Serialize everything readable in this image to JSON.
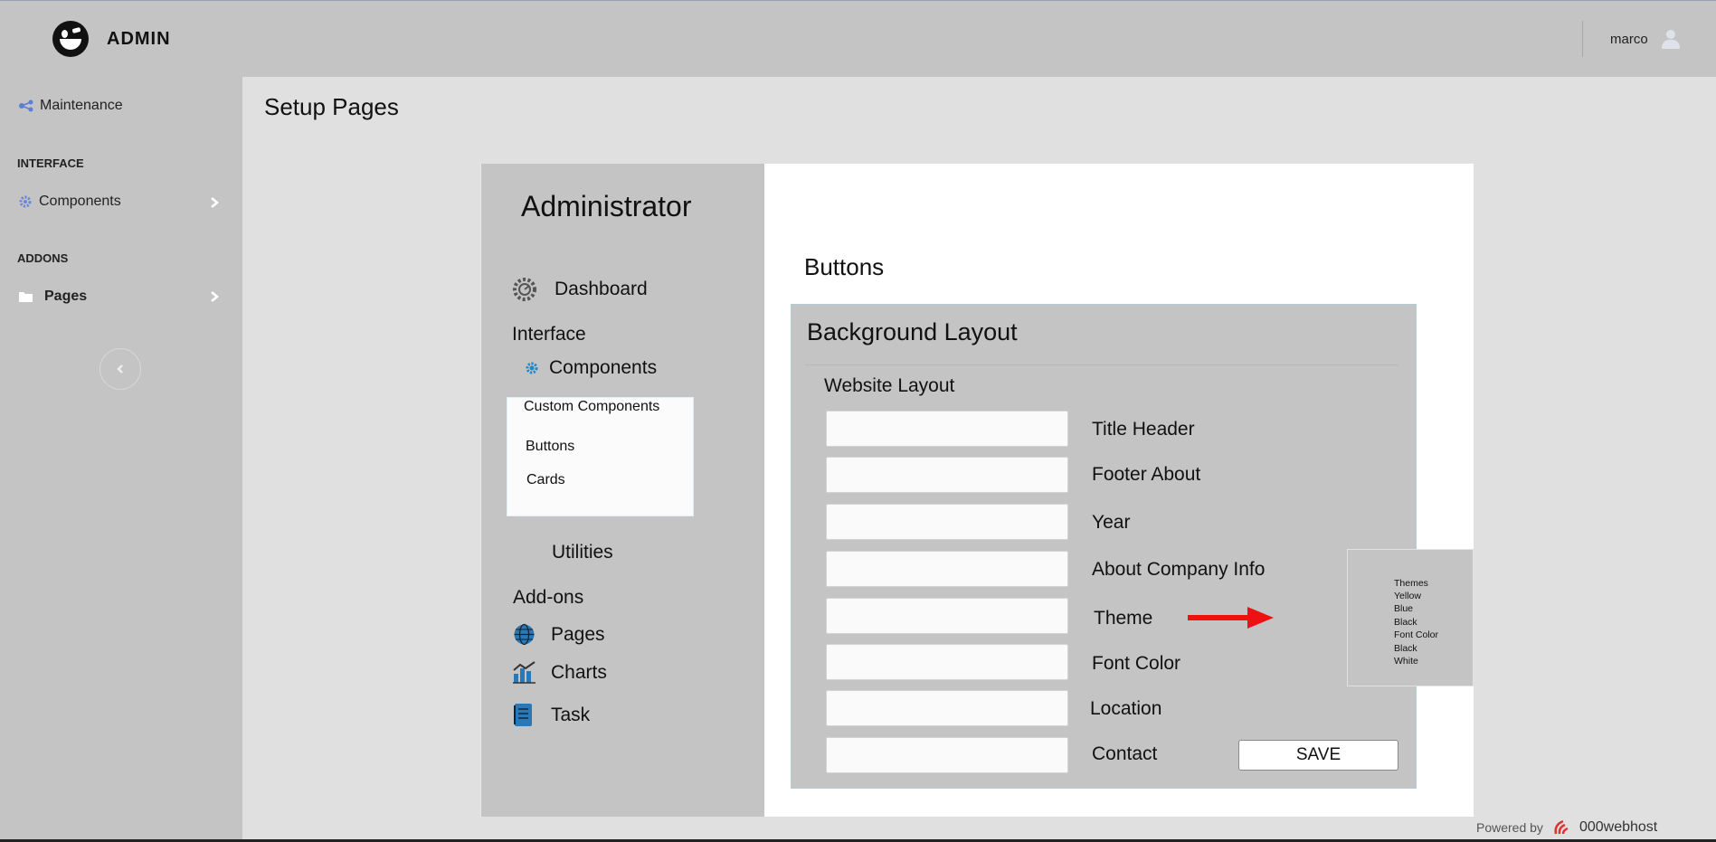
{
  "app": {
    "brand": "ADMIN"
  },
  "user": {
    "name": "marco"
  },
  "sidebar": {
    "maintenance": "Maintenance",
    "interface_heading": "INTERFACE",
    "components": "Components",
    "addons_heading": "ADDONS",
    "pages": "Pages"
  },
  "page": {
    "title": "Setup Pages"
  },
  "preview": {
    "title": "Administrator",
    "dashboard": "Dashboard",
    "interface": "Interface",
    "components": "Components",
    "submenu": [
      "Custom Components",
      "Buttons",
      "Cards"
    ],
    "utilities": "Utilities",
    "addons": "Add-ons",
    "pages": "Pages",
    "charts": "Charts",
    "task": "Task"
  },
  "main": {
    "section_title": "Buttons",
    "panel_title": "Background Layout",
    "subheading": "Website Layout",
    "fields": [
      {
        "label": "Title Header",
        "value": ""
      },
      {
        "label": "Footer About",
        "value": ""
      },
      {
        "label": "Year",
        "value": ""
      },
      {
        "label": "About Company Info",
        "value": ""
      },
      {
        "label": "Theme",
        "value": ""
      },
      {
        "label": "Font Color",
        "value": ""
      },
      {
        "label": "Location",
        "value": ""
      },
      {
        "label": "Contact",
        "value": ""
      }
    ],
    "save_label": "SAVE"
  },
  "dropdown": {
    "items": [
      "Themes",
      "Yellow",
      "Blue",
      "Black",
      "Font Color",
      "Black",
      "White"
    ]
  },
  "footer": {
    "powered": "Powered by",
    "host": "000webhost"
  },
  "colors": {
    "accent_arrow": "#ee1111",
    "icon_blue": "#2a78b5"
  }
}
